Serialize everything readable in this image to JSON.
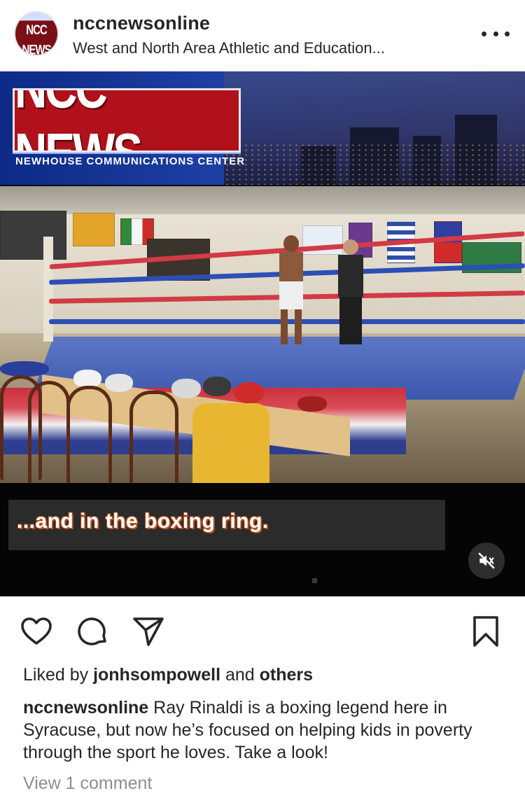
{
  "post_header": {
    "username": "nccnewsonline",
    "location": "West and North Area Athletic and Education...",
    "avatar_text": "NCC NEWS"
  },
  "media": {
    "logo_title": "NCC NEWS",
    "logo_subtitle": "NEWHOUSE COMMUNICATIONS CENTER",
    "video_caption": "...and in the boxing ring.",
    "audio_state": "muted"
  },
  "actions": {
    "like_icon": "heart-icon",
    "comment_icon": "comment-icon",
    "share_icon": "paper-plane-icon",
    "save_icon": "bookmark-icon"
  },
  "likes": {
    "prefix": "Liked by ",
    "user": "jonhsompowell",
    "middle": " and ",
    "others": "others"
  },
  "caption": {
    "username": "nccnewsonline",
    "text": " Ray Rinaldi is a boxing legend here in Syracuse, but now he’s focused on helping kids in poverty through the sport he loves. Take a look!"
  },
  "comments": {
    "view_label": "View 1 comment"
  },
  "colors": {
    "text": "#262626",
    "muted_text": "#8e8e8e",
    "logo_red": "#b0111b",
    "banner_blue": "#1d3fa3"
  }
}
